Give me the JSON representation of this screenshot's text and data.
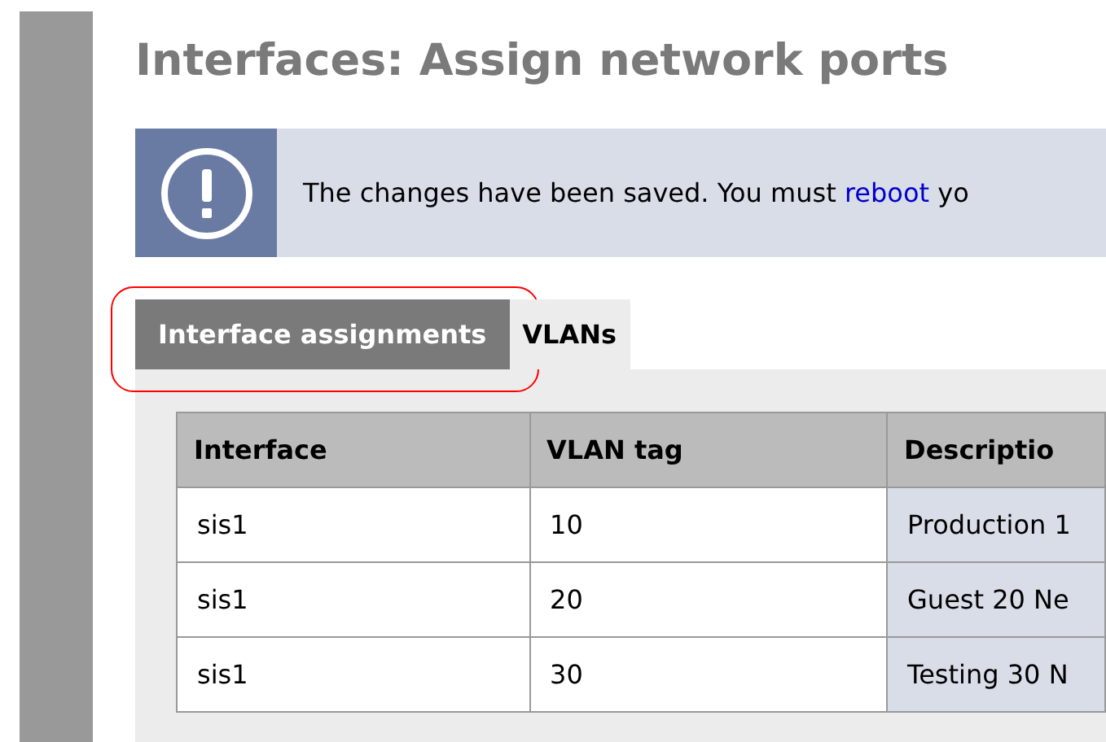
{
  "page_title": "Interfaces: Assign network ports",
  "notice": {
    "text_before": "The changes have been saved. You must",
    "link": "reboot",
    "text_after": "yo"
  },
  "tabs": [
    {
      "label": "Interface assignments",
      "selected": true,
      "highlighted": true
    },
    {
      "label": "VLANs",
      "selected": false,
      "highlighted": false
    }
  ],
  "table": {
    "columns": [
      "Interface",
      "VLAN tag",
      "Descriptio"
    ],
    "rows": [
      [
        "sis1",
        "10",
        "Production 1"
      ],
      [
        "sis1",
        "20",
        "Guest 20 Ne"
      ],
      [
        "sis1",
        "30",
        "Testing 30 N"
      ]
    ]
  }
}
